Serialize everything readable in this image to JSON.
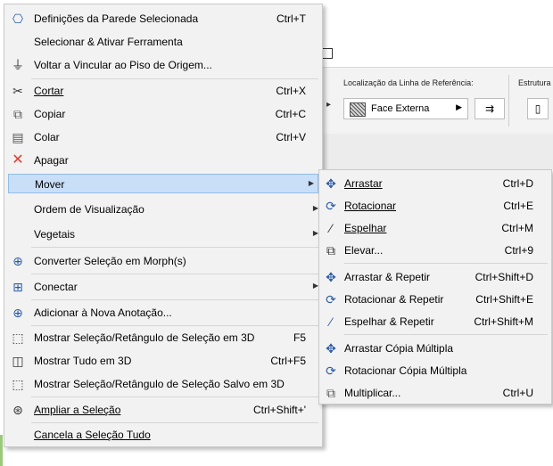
{
  "background": {
    "ribbon_group_reference": "Localização da Linha de Referência:",
    "ribbon_group_structure": "Estrutura",
    "face_combo_value": "Face Externa"
  },
  "main_menu": {
    "items": [
      {
        "label": "Definições da Parede Selecionada",
        "shortcut": "Ctrl+T",
        "icon": "wall-settings-icon"
      },
      {
        "label": "Selecionar & Ativar Ferramenta",
        "shortcut": "",
        "icon": ""
      },
      {
        "label": "Voltar a Vincular ao Piso de Origem...",
        "shortcut": "",
        "icon": "relink-story-icon"
      },
      {
        "label": "Cortar",
        "shortcut": "Ctrl+X",
        "icon": "scissors-icon"
      },
      {
        "label": "Copiar",
        "shortcut": "Ctrl+C",
        "icon": "copy-icon"
      },
      {
        "label": "Colar",
        "shortcut": "Ctrl+V",
        "icon": "paste-icon"
      },
      {
        "label": "Apagar",
        "shortcut": "",
        "icon": "delete-x-icon"
      },
      {
        "label": "Mover",
        "shortcut": "",
        "icon": ""
      },
      {
        "label": "Ordem de Visualização",
        "shortcut": "",
        "icon": ""
      },
      {
        "label": "Vegetais",
        "shortcut": "",
        "icon": ""
      },
      {
        "label": "Converter Seleção em Morph(s)",
        "shortcut": "",
        "icon": "morph-icon"
      },
      {
        "label": "Conectar",
        "shortcut": "",
        "icon": "connect-icon"
      },
      {
        "label": "Adicionar à Nova Anotação...",
        "shortcut": "",
        "icon": "annotation-icon"
      },
      {
        "label": "Mostrar Seleção/Retângulo de Seleção em 3D",
        "shortcut": "F5",
        "icon": "show-3d-selection-icon"
      },
      {
        "label": "Mostrar Tudo em 3D",
        "shortcut": "Ctrl+F5",
        "icon": "show-all-3d-icon"
      },
      {
        "label": "Mostrar Seleção/Retângulo de Seleção Salvo em 3D",
        "shortcut": "",
        "icon": "show-saved-3d-icon"
      },
      {
        "label": "Ampliar a Seleção",
        "shortcut": "Ctrl+Shift+'",
        "icon": "zoom-selection-icon"
      },
      {
        "label": "Cancela a Seleção Tudo",
        "shortcut": "",
        "icon": ""
      }
    ]
  },
  "sub_menu": {
    "items": [
      {
        "label": "Arrastar",
        "shortcut": "Ctrl+D",
        "icon": "drag-icon"
      },
      {
        "label": "Rotacionar",
        "shortcut": "Ctrl+E",
        "icon": "rotate-icon"
      },
      {
        "label": "Espelhar",
        "shortcut": "Ctrl+M",
        "icon": "mirror-icon"
      },
      {
        "label": "Elevar...",
        "shortcut": "Ctrl+9",
        "icon": "elevate-icon"
      },
      {
        "label": "Arrastar & Repetir",
        "shortcut": "Ctrl+Shift+D",
        "icon": "drag-repeat-icon"
      },
      {
        "label": "Rotacionar & Repetir",
        "shortcut": "Ctrl+Shift+E",
        "icon": "rotate-repeat-icon"
      },
      {
        "label": "Espelhar & Repetir",
        "shortcut": "Ctrl+Shift+M",
        "icon": "mirror-repeat-icon"
      },
      {
        "label": "Arrastar Cópia Múltipla",
        "shortcut": "",
        "icon": "drag-multi-copy-icon"
      },
      {
        "label": "Rotacionar Cópia Múltipla",
        "shortcut": "",
        "icon": "rotate-multi-copy-icon"
      },
      {
        "label": "Multiplicar...",
        "shortcut": "Ctrl+U",
        "icon": "multiply-icon"
      }
    ]
  },
  "colors": {
    "menu_bg": "#f2f2f2",
    "highlight_bg": "#c9dff8",
    "highlight_border": "#92bcea",
    "icon_blue": "#2b5aa5",
    "delete_red": "#e23b2e"
  }
}
